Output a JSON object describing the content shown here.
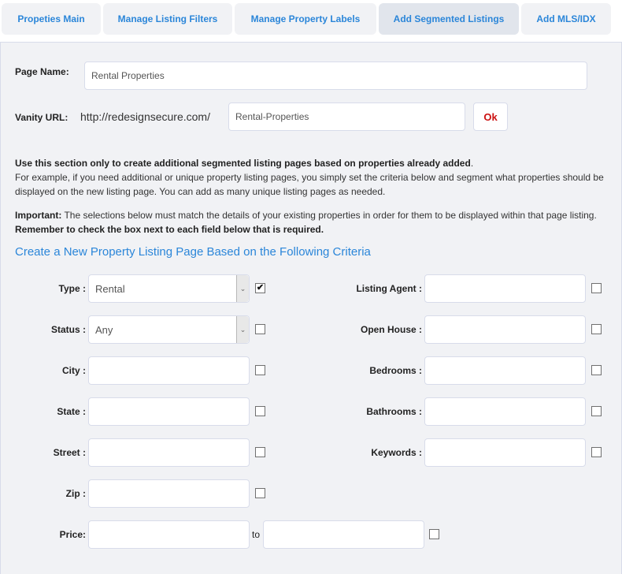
{
  "tabs": [
    {
      "label": "Propeties Main",
      "active": false
    },
    {
      "label": "Manage Listing Filters",
      "active": false
    },
    {
      "label": "Manage Property Labels",
      "active": false
    },
    {
      "label": "Add Segmented Listings",
      "active": true
    },
    {
      "label": "Add MLS/IDX",
      "active": false
    }
  ],
  "page_name": {
    "label": "Page Name:",
    "value": "Rental Properties"
  },
  "vanity_url": {
    "label": "Vanity URL:",
    "prefix": "http://redesignsecure.com/",
    "value": "Rental-Properties",
    "ok_label": "Ok"
  },
  "info": {
    "line1_bold": "Use this section only to create additional segmented listing pages based on properties already added",
    "line1_end": ".",
    "line2": "For example, if you need additional or unique property listing pages, you simply set the criteria below and segment what properties should be displayed on the new listing page. You can add as many unique listing pages as needed.",
    "important_bold": "Important:",
    "important_text": " The selections below must match the details of your existing properties in order for them to be displayed within that page listing. ",
    "remember_bold": "Remember to check the box next to each field below that is required."
  },
  "section_title": "Create a New Property Listing Page Based on the Following Criteria",
  "criteria": {
    "type": {
      "label": "Type :",
      "value": "Rental",
      "checked": true
    },
    "status": {
      "label": "Status :",
      "value": "Any",
      "checked": false
    },
    "city": {
      "label": "City :",
      "value": "",
      "checked": false
    },
    "state": {
      "label": "State :",
      "value": "",
      "checked": false
    },
    "street": {
      "label": "Street :",
      "value": "",
      "checked": false
    },
    "zip": {
      "label": "Zip :",
      "value": "",
      "checked": false
    },
    "price": {
      "label": "Price:",
      "from": "",
      "to_label": "to",
      "to": "",
      "checked": false
    },
    "listing_agent": {
      "label": "Listing Agent :",
      "value": "",
      "checked": false
    },
    "open_house": {
      "label": "Open House :",
      "value": "",
      "checked": false
    },
    "bedrooms": {
      "label": "Bedrooms :",
      "value": "",
      "checked": false
    },
    "bathrooms": {
      "label": "Bathrooms :",
      "value": "",
      "checked": false
    },
    "keywords": {
      "label": "Keywords :",
      "value": "",
      "checked": false
    }
  },
  "icons": {
    "checkmark": "✔",
    "dropdown_arrow": "⌄"
  }
}
